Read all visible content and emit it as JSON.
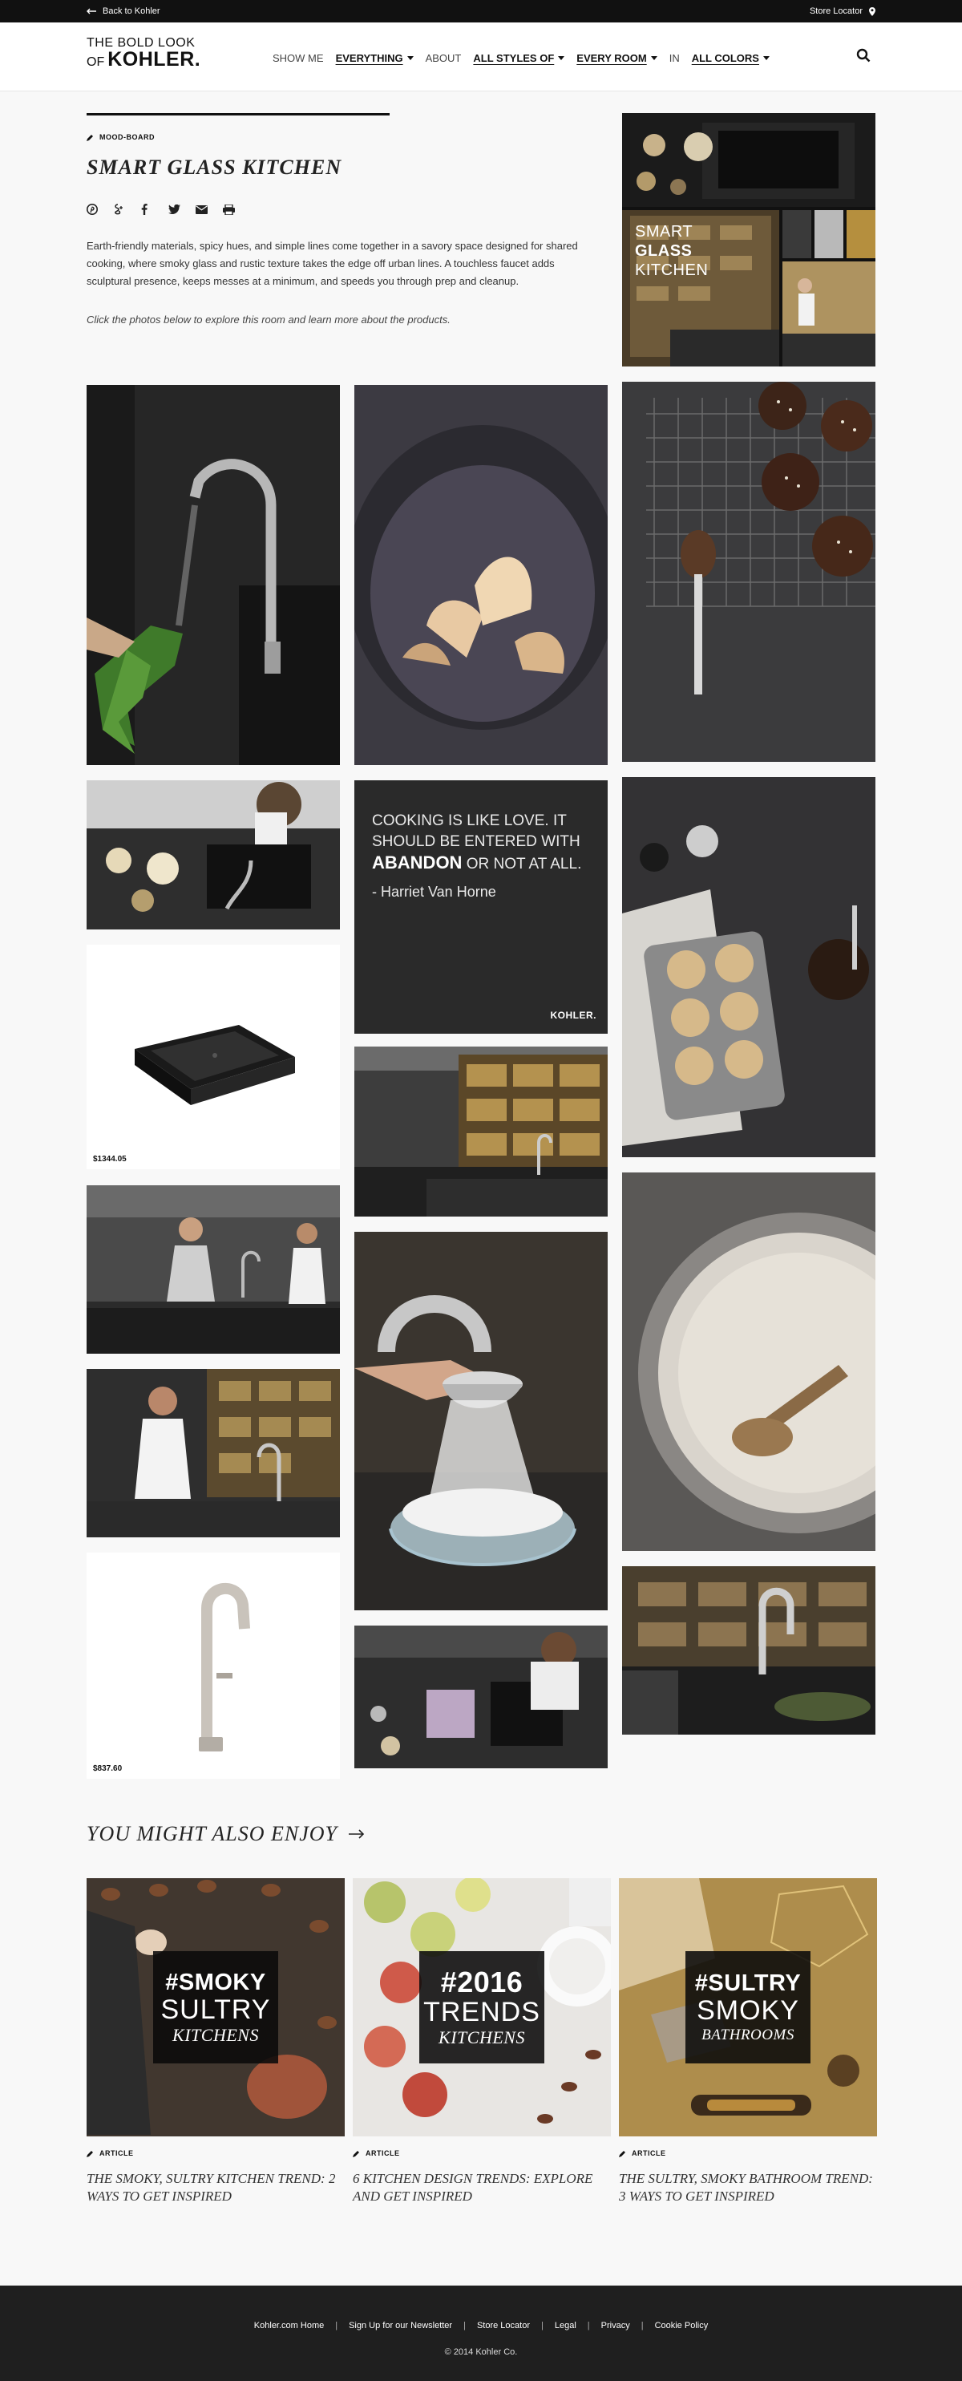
{
  "topbar": {
    "back_label": "Back to Kohler",
    "store_label": "Store Locator"
  },
  "logo": {
    "line1": "THE BOLD LOOK",
    "line2_of": "OF",
    "line2_brand": "KOHLER."
  },
  "nav": {
    "show_me": "SHOW ME",
    "everything": "EVERYTHING",
    "about": "ABOUT",
    "styles": "ALL STYLES OF",
    "room": "EVERY ROOM",
    "in": "IN",
    "colors": "ALL COLORS"
  },
  "page": {
    "tag": "MOOD-BOARD",
    "title": "SMART GLASS KITCHEN",
    "description": "Earth-friendly materials, spicy hues, and simple lines come together in a savory space designed for shared cooking, where smoky glass and rustic texture takes the edge off urban lines. A touchless faucet adds sculptural presence, keeps messes at a minimum, and speeds you through prep and cleanup.",
    "instruction": "Click the photos below to explore this room and learn more about the products.",
    "share_icons": [
      "pinterest-icon",
      "google-plus-icon",
      "facebook-icon",
      "twitter-icon",
      "email-icon",
      "print-icon"
    ]
  },
  "collage": {
    "line1": "SMART",
    "line2": "GLASS",
    "line3": "KITCHEN"
  },
  "quote": {
    "line_a": "COOKING IS LIKE LOVE. IT SHOULD BE ENTERED WITH",
    "bold": "ABANDON",
    "line_b": "OR NOT AT ALL.",
    "author": "- Harriet Van Horne",
    "brand": "KOHLER."
  },
  "products": {
    "sink_price": "$1344.05",
    "faucet_price": "$837.60"
  },
  "also": {
    "heading": "YOU MIGHT ALSO ENJOY",
    "cards": [
      {
        "tag": "ARTICLE",
        "hash": "#SMOKY",
        "mid": "SULTRY",
        "sub": "KITCHENS",
        "title": "THE SMOKY, SULTRY KITCHEN TREND: 2 WAYS TO GET INSPIRED"
      },
      {
        "tag": "ARTICLE",
        "hash": "#2016",
        "mid": "TRENDS",
        "sub": "KITCHENS",
        "title": "6 KITCHEN DESIGN TRENDS: EXPLORE AND GET INSPIRED"
      },
      {
        "tag": "ARTICLE",
        "hash": "#SULTRY",
        "mid": "SMOKY",
        "sub": "BATHROOMS",
        "title": "THE SULTRY, SMOKY BATHROOM TREND: 3 WAYS TO GET INSPIRED"
      }
    ]
  },
  "footer": {
    "links": [
      "Kohler.com Home",
      "Sign Up for our Newsletter",
      "Store Locator",
      "Legal",
      "Privacy",
      "Cookie Policy"
    ],
    "copyright": "© 2014 Kohler Co."
  }
}
